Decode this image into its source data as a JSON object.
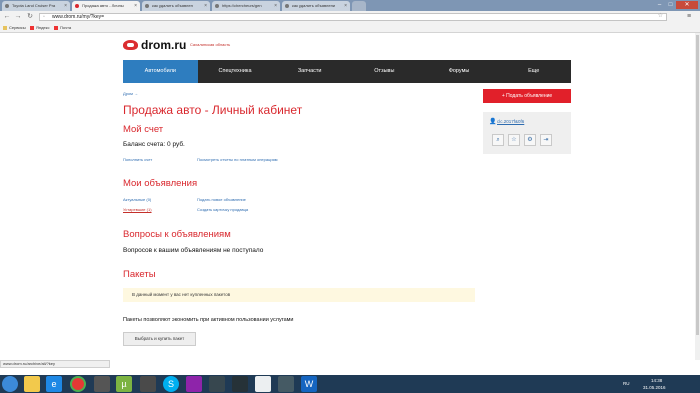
{
  "browser": {
    "tabs": [
      {
        "label": "Toyota Land Cruiser Pra"
      },
      {
        "label": "Продажа авто - Личны"
      },
      {
        "label": "как удалить объявлен"
      },
      {
        "label": "https://chercheurs/gen"
      },
      {
        "label": "как удалить объявлени"
      }
    ],
    "url": "www.drom.ru/my/?key=",
    "bookmarks": [
      {
        "label": "Сервисы"
      },
      {
        "label": "Яндекс"
      },
      {
        "label": "Почта"
      }
    ]
  },
  "site": {
    "logo": "drom.ru",
    "region": "Сахалинская область",
    "nav": [
      {
        "label": "Автомобили"
      },
      {
        "label": "Спецтехника"
      },
      {
        "label": "Запчасти"
      },
      {
        "label": "Отзывы"
      },
      {
        "label": "Форумы"
      },
      {
        "label": "Еще"
      }
    ],
    "breadcrumb": "Дром →"
  },
  "main": {
    "title": "Продажа авто - Личный кабинет",
    "account": {
      "heading": "Мой счет",
      "balance": "Баланс счета: 0 руб.",
      "topup": "Пополнить счет",
      "reports": "Посмотреть отчеты по платным операциям"
    },
    "ads": {
      "heading": "Мои объявления",
      "active": "Актуальные (0)",
      "archived": "Устаревшие (1)",
      "new_ad": "Подать новое объявление",
      "sale_card": "Создать карточку продавца"
    },
    "questions": {
      "heading": "Вопросы к объявлениям",
      "text": "Вопросов к вашим объявлениям не поступало"
    },
    "packages": {
      "heading": "Пакеты",
      "notice": "В данный момент у вас нет купленных пакетов",
      "description": "Пакеты позволяют экономить при активном пользовании услугами",
      "buy_button": "Выбрать и купить пакет"
    }
  },
  "sidebar": {
    "add_button": "Подать объявление",
    "username": "clc.2017f&0f6"
  },
  "status": {
    "url": "www.drom.ru/archive/all/?key"
  },
  "taskbar": {
    "lang": "RU",
    "time": "14:38",
    "date": "31.05.2016"
  },
  "colors": {
    "brand_red": "#d9282e",
    "nav_active": "#2e7dbf",
    "nav_bg": "#2a2a2a",
    "link": "#2e6cb0"
  }
}
